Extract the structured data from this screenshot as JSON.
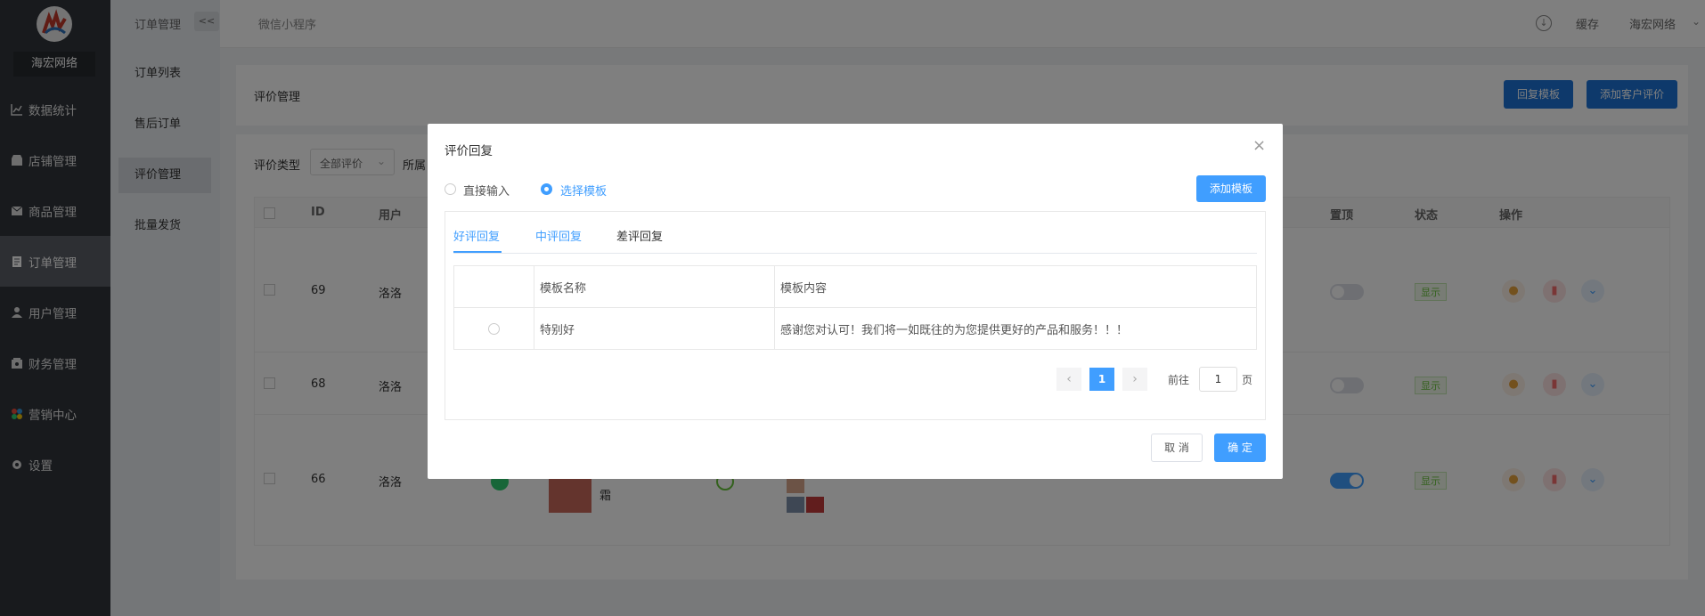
{
  "brand": "海宏网络",
  "sidebar": {
    "items": [
      {
        "label": "数据统计",
        "icon": "chart-icon"
      },
      {
        "label": "店铺管理",
        "icon": "store-icon"
      },
      {
        "label": "商品管理",
        "icon": "goods-icon"
      },
      {
        "label": "订单管理",
        "icon": "order-icon",
        "active": true
      },
      {
        "label": "用户管理",
        "icon": "user-icon"
      },
      {
        "label": "财务管理",
        "icon": "finance-icon"
      },
      {
        "label": "营销中心",
        "icon": "marketing-icon"
      },
      {
        "label": "设置",
        "icon": "gear-icon"
      }
    ]
  },
  "submenu": {
    "title": "订单管理",
    "collapse": "<<",
    "items": [
      "订单列表",
      "售后订单",
      "评价管理",
      "批量发货"
    ]
  },
  "topbar": {
    "tab": "微信小程序",
    "cache": "缓存",
    "user": "海宏网络"
  },
  "page": {
    "title": "评价管理",
    "reply_template_btn": "回复模板",
    "add_review_btn": "添加客户评价",
    "filter_label": "评价类型",
    "filter_value": "全部评价",
    "filter_label2": "所属",
    "table_headers": [
      "ID",
      "用户",
      "置顶",
      "状态",
      "操作"
    ],
    "rows": [
      {
        "id": "69",
        "user": "洛洛",
        "status": "显示"
      },
      {
        "id": "68",
        "user": "洛洛",
        "status": "显示"
      },
      {
        "id": "66",
        "user": "洛洛",
        "status": "显示",
        "extra": "霜"
      }
    ]
  },
  "dialog": {
    "title": "评价回复",
    "radio_direct": "直接输入",
    "radio_template": "选择模板",
    "add_template_btn": "添加模板",
    "tabs": [
      "好评回复",
      "中评回复",
      "差评回复"
    ],
    "table": {
      "headers": [
        "模板名称",
        "模板内容"
      ],
      "rows": [
        {
          "name": "特别好",
          "content": "感谢您对认可！我们将一如既往的为您提供更好的产品和服务！！！"
        }
      ]
    },
    "pagination": {
      "page": "1",
      "goto_label": "前往",
      "goto_value": "1",
      "page_suffix": "页"
    },
    "cancel": "取 消",
    "confirm": "确 定"
  },
  "colors": {
    "primary": "#409eff",
    "sidebar": "#30353b",
    "status_green": "#67c23a"
  }
}
